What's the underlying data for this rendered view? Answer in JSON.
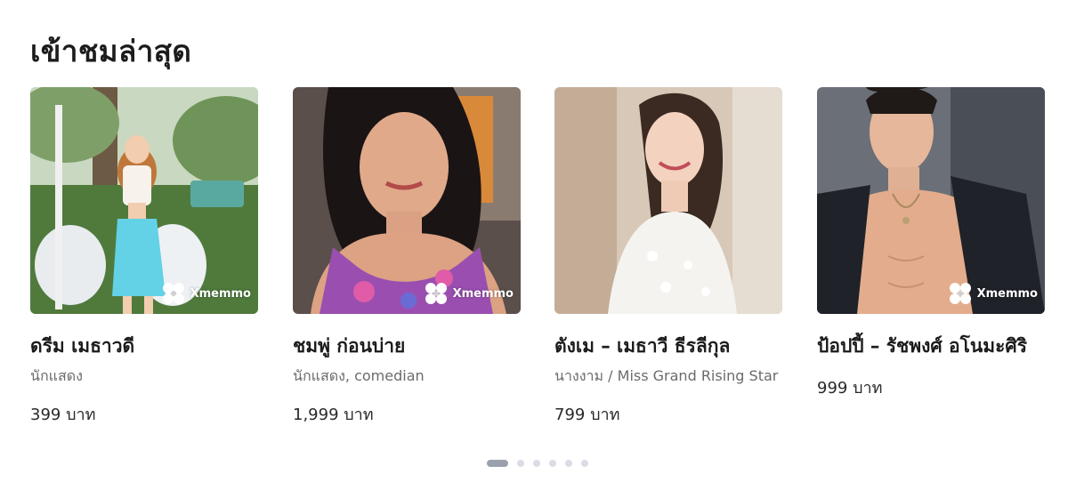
{
  "section": {
    "title": "เข้าชมล่าสุด"
  },
  "watermark": {
    "brand": "Xmemmo",
    "icon": "xmemmo-logo-icon"
  },
  "cards": [
    {
      "name": "ดรีม เมธาวดี",
      "role": "นักแสดง",
      "price": "399 บาท"
    },
    {
      "name": "ชมพู่ ก่อนบ่าย",
      "role": "นักแสดง, comedian",
      "price": "1,999 บาท"
    },
    {
      "name": "ตังเม – เมธาวี ธีรลีกุล",
      "role": "นางงาม / Miss Grand Rising Star",
      "price": "799 บาท"
    },
    {
      "name": "ป้อปปี้ – รัชพงศ์ อโนมะศิริ",
      "role": "",
      "price": "999 บาท"
    }
  ],
  "pager": {
    "total": 6,
    "active_index": 0
  },
  "colors": {
    "pager_active": "#9aa1ad",
    "pager_inactive": "#d9dde3",
    "muted_text": "#6b6b6b"
  }
}
